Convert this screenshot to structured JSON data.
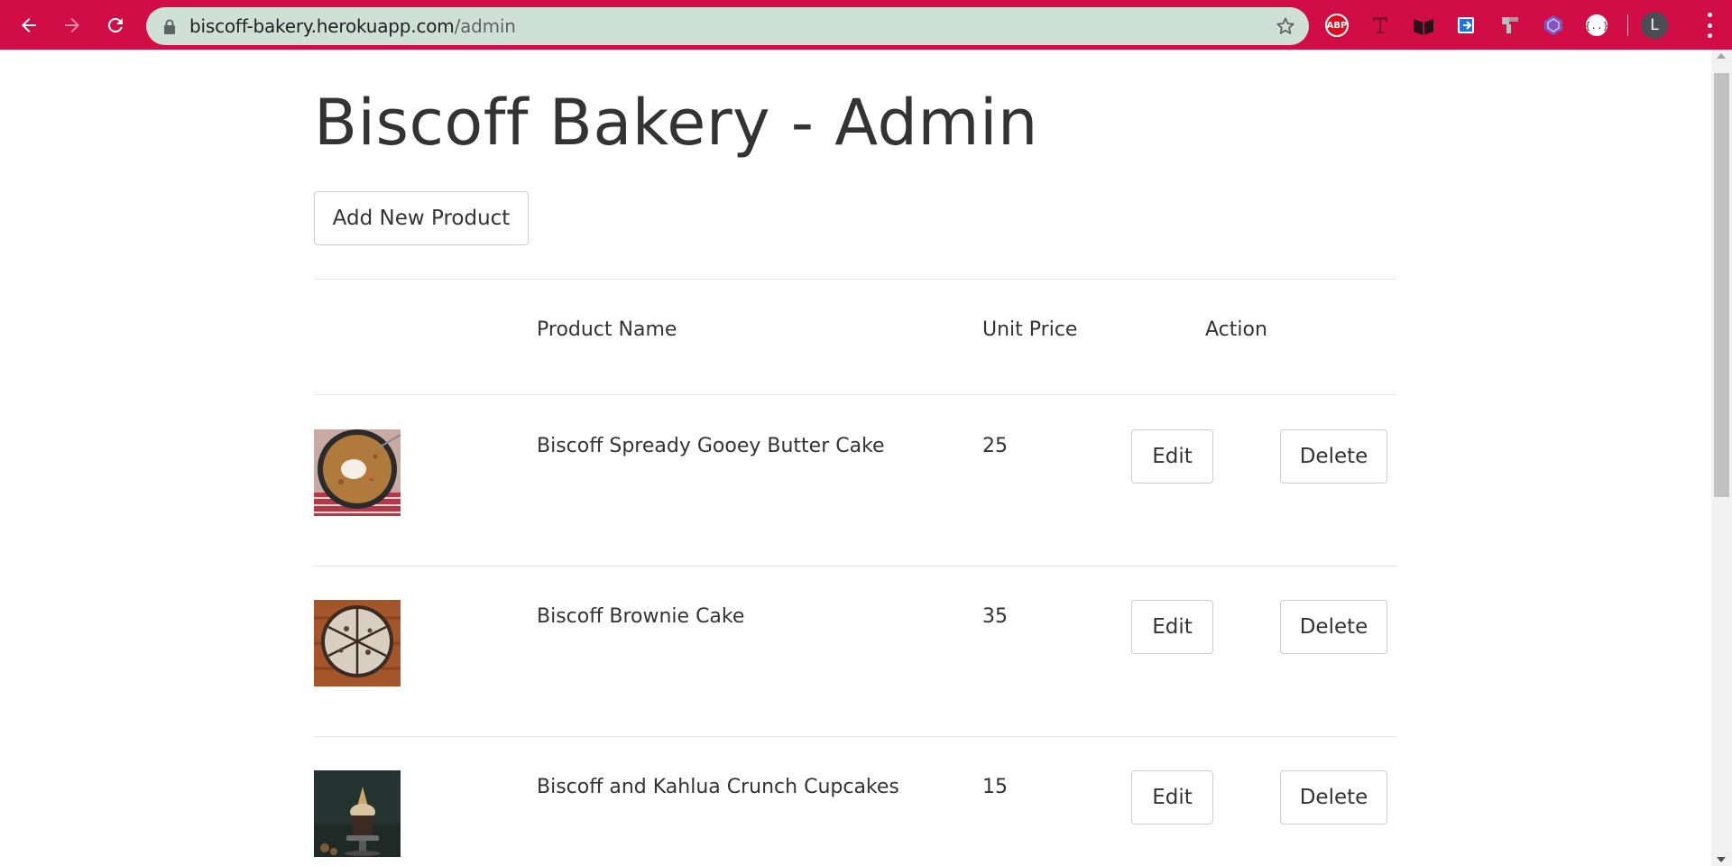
{
  "browser": {
    "url_host": "biscoff-bakery.herokuapp.com",
    "url_path": "/admin",
    "profile_initial": "L",
    "extensions": [
      "abp-icon",
      "translate-icon",
      "reading-icon",
      "screenshot-icon",
      "pattern-icon",
      "hex-icon",
      "json-icon"
    ],
    "abp_label": "ABP",
    "accent_color": "#d10d45"
  },
  "page": {
    "title": "Biscoff Bakery - Admin",
    "add_button_label": "Add New Product"
  },
  "table": {
    "headers": {
      "name": "Product Name",
      "price": "Unit Price",
      "action": "Action"
    },
    "rows": [
      {
        "name": "Biscoff Spready Gooey Butter Cake",
        "price": "25",
        "edit_label": "Edit",
        "delete_label": "Delete",
        "image": "butter-cake-skillet"
      },
      {
        "name": "Biscoff Brownie Cake",
        "price": "35",
        "edit_label": "Edit",
        "delete_label": "Delete",
        "image": "brownie-cake-slices"
      },
      {
        "name": "Biscoff and Kahlua Crunch Cupcakes",
        "price": "15",
        "edit_label": "Edit",
        "delete_label": "Delete",
        "image": "kahlua-cupcake"
      }
    ]
  }
}
